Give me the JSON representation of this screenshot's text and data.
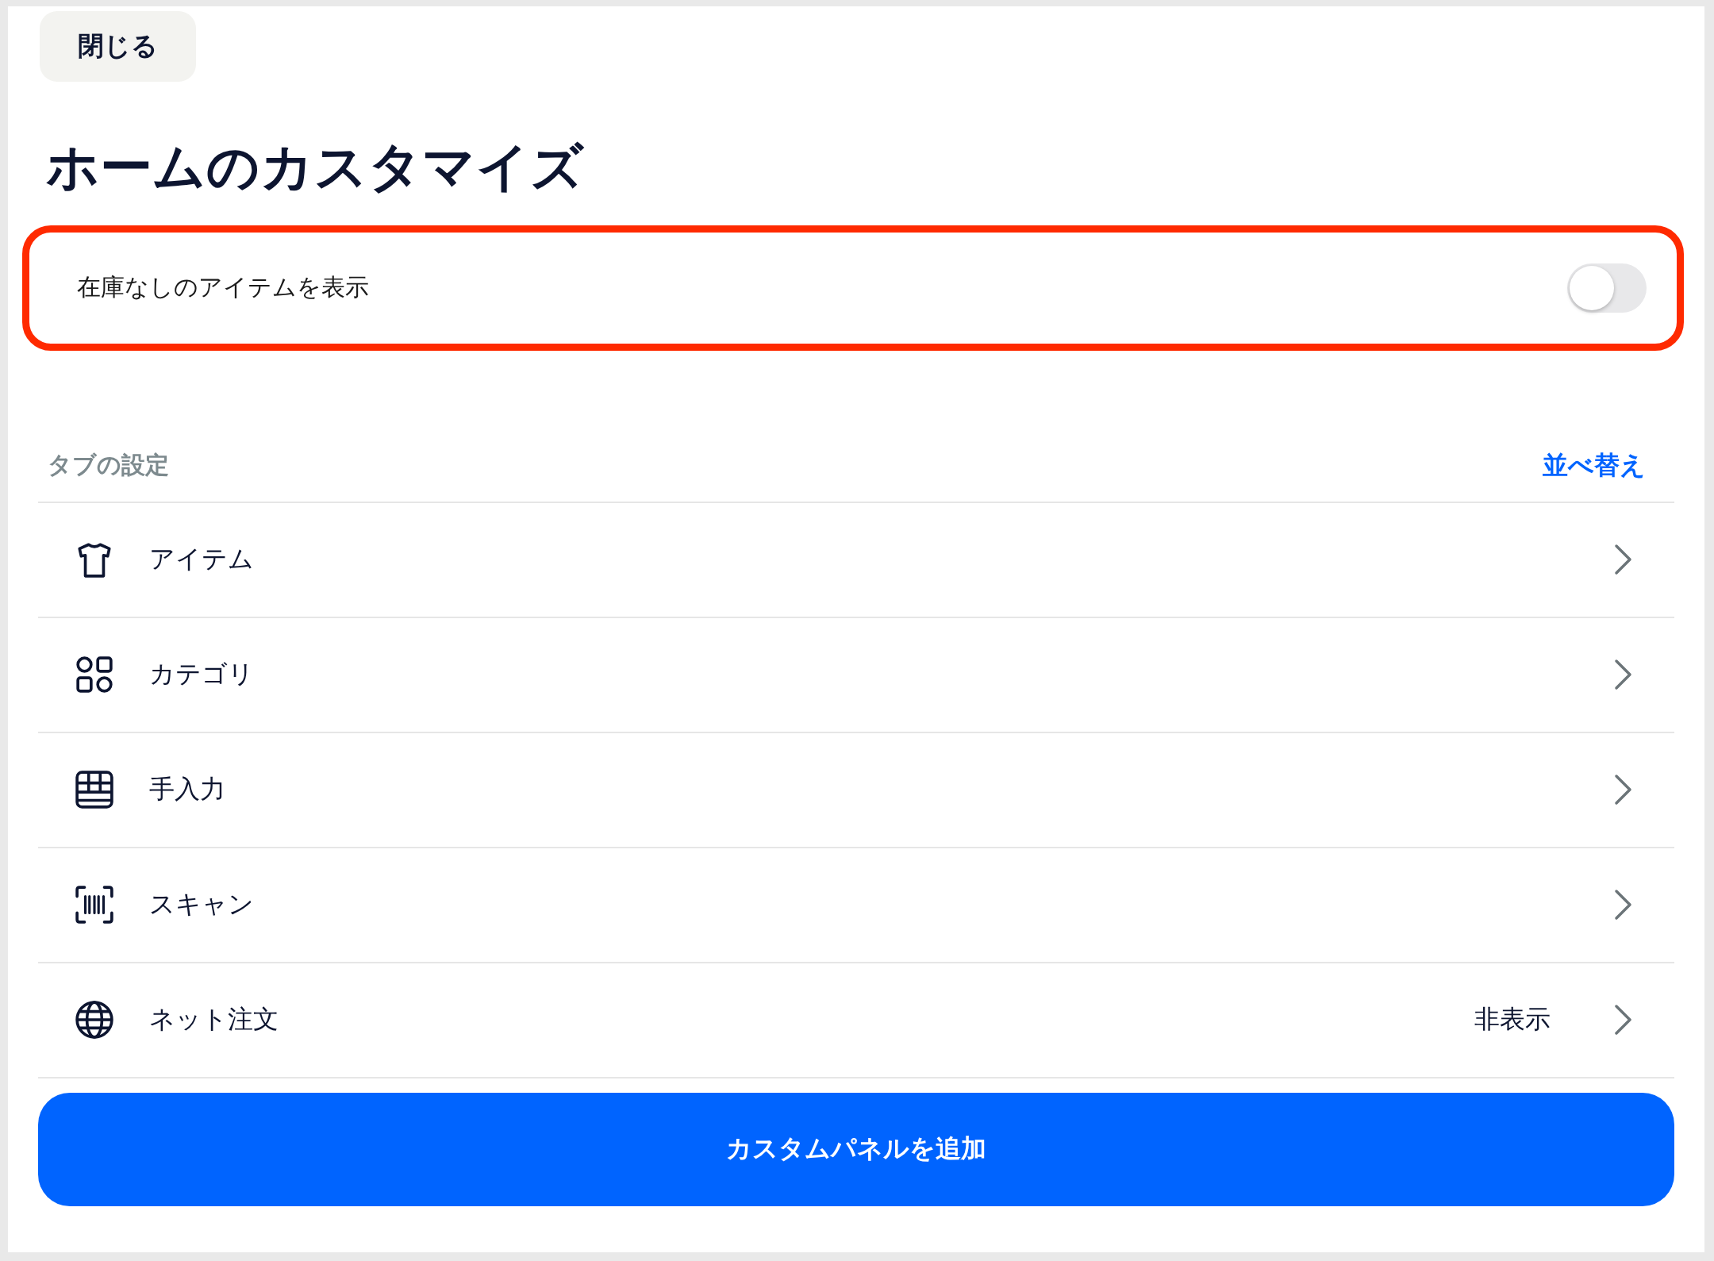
{
  "close_button": "閉じる",
  "title": "ホームのカスタマイズ",
  "stock_toggle": {
    "label": "在庫なしのアイテムを表示",
    "on": false,
    "highlighted": true
  },
  "tab_settings": {
    "heading": "タブの設定",
    "sort_link": "並べ替え",
    "items": [
      {
        "kind": "shirt",
        "label": "アイテム"
      },
      {
        "kind": "shapes",
        "label": "カテゴリ"
      },
      {
        "kind": "grid",
        "label": "手入力"
      },
      {
        "kind": "barcode",
        "label": "スキャン"
      },
      {
        "kind": "globe",
        "label": "ネット注文",
        "status": "非表示"
      }
    ]
  },
  "add_button": "カスタムパネルを追加"
}
